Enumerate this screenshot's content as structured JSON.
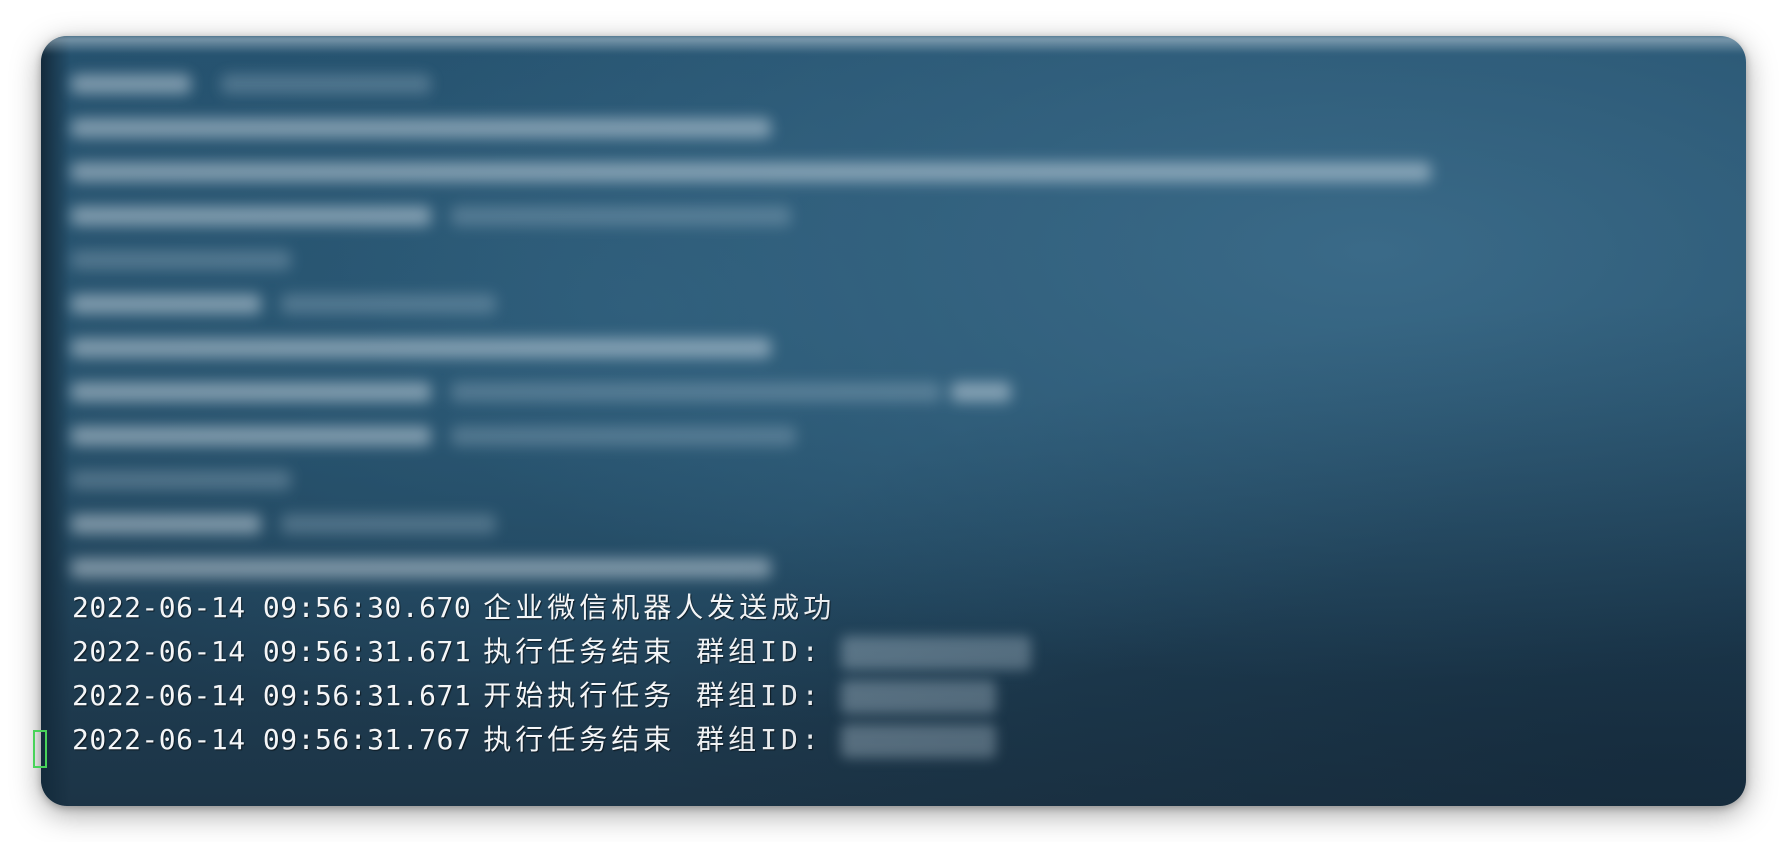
{
  "terminal": {
    "log_lines": [
      {
        "timestamp": "2022-06-14 09:56:30.670",
        "message": "企业微信机器人发送成功"
      },
      {
        "timestamp": "2022-06-14 09:56:31.671",
        "message": "执行任务结束 群组ID:"
      },
      {
        "timestamp": "2022-06-14 09:56:31.671",
        "message": "开始执行任务 群组ID:"
      },
      {
        "timestamp": "2022-06-14 09:56:31.767",
        "message": "执行任务结束 群组ID:"
      }
    ],
    "cursor_color": "#49d35a",
    "text_color": "#f4f6f8"
  }
}
